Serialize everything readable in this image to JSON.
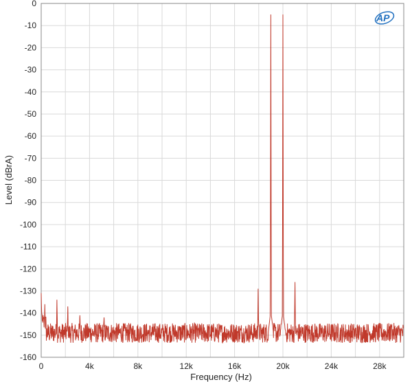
{
  "chart_data": {
    "type": "line",
    "title": "",
    "xlabel": "Frequency (Hz)",
    "ylabel": "Level (dBrA)",
    "xlim": [
      0,
      30000
    ],
    "ylim": [
      -160,
      0
    ],
    "grid": true,
    "legend": "none",
    "x_ticks": [
      0,
      4000,
      8000,
      12000,
      16000,
      20000,
      24000,
      28000
    ],
    "x_tick_labels": [
      "0",
      "4k",
      "8k",
      "12k",
      "16k",
      "20k",
      "24k",
      "28k"
    ],
    "y_ticks": [
      0,
      -10,
      -20,
      -30,
      -40,
      -50,
      -60,
      -70,
      -80,
      -90,
      -100,
      -110,
      -120,
      -130,
      -140,
      -150,
      -160
    ],
    "y_tick_labels": [
      "0",
      "-10",
      "-20",
      "-30",
      "-40",
      "-50",
      "-60",
      "-70",
      "-80",
      "-90",
      "-100",
      "-110",
      "-120",
      "-130",
      "-140",
      "-150",
      "-160"
    ],
    "series": [
      {
        "color": "#c0392b",
        "noise_floor": -149,
        "points": [
          {
            "x": 0,
            "y": -131
          },
          {
            "x": 150,
            "y": -141
          },
          {
            "x": 300,
            "y": -136
          },
          {
            "x": 1300,
            "y": -134
          },
          {
            "x": 2200,
            "y": -137
          },
          {
            "x": 3200,
            "y": -141
          },
          {
            "x": 5200,
            "y": -142
          },
          {
            "x": 17950,
            "y": -129
          },
          {
            "x": 19000,
            "y": -5
          },
          {
            "x": 20000,
            "y": -5
          },
          {
            "x": 21000,
            "y": -126
          },
          {
            "x": 29000,
            "y": -145
          }
        ]
      }
    ]
  },
  "logo": {
    "text": "AP"
  }
}
